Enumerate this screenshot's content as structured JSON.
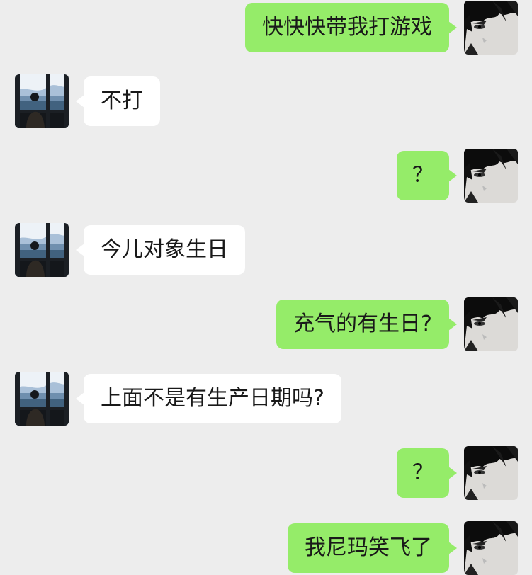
{
  "chat": {
    "messages": [
      {
        "side": "out",
        "text": "快快快带我打游戏"
      },
      {
        "side": "in",
        "text": "不打"
      },
      {
        "side": "out",
        "text": "？"
      },
      {
        "side": "in",
        "text": "今儿对象生日"
      },
      {
        "side": "out",
        "text": "充气的有生日?"
      },
      {
        "side": "in",
        "text": "上面不是有生产日期吗?"
      },
      {
        "side": "out",
        "text": "？"
      },
      {
        "side": "out",
        "text": "我尼玛笑飞了"
      }
    ]
  },
  "colors": {
    "background": "#ededed",
    "outgoing_bubble": "#95ec69",
    "incoming_bubble": "#ffffff"
  },
  "avatars": {
    "outgoing": "anime-man-avatar",
    "incoming": "window-silhouette-avatar"
  }
}
